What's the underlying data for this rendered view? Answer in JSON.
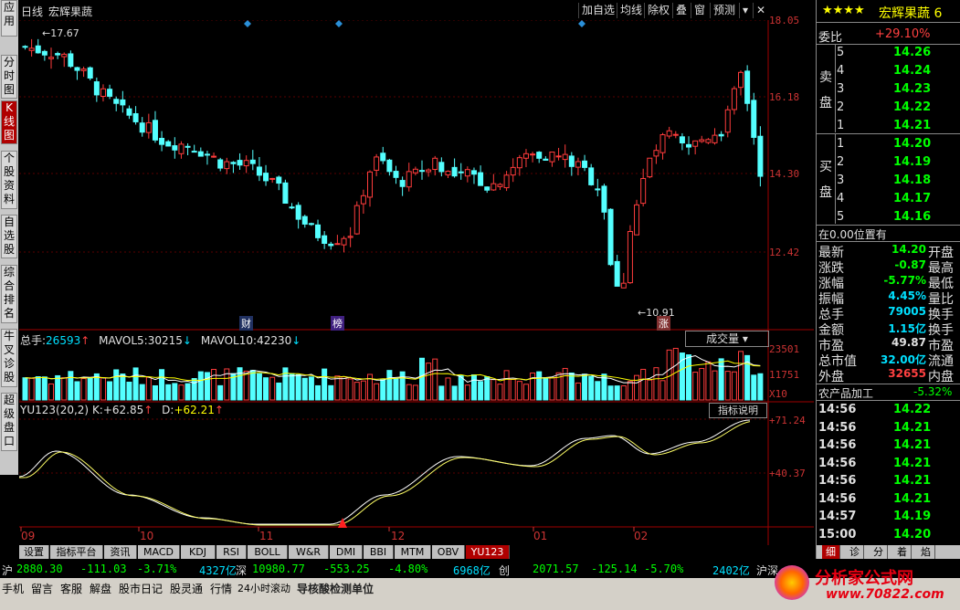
{
  "left_tabs": [
    "应用",
    "分时图",
    "K线图",
    "个股资料",
    "自选股",
    "综合排名",
    "牛叉诊股",
    "超级盘口"
  ],
  "toolbar": {
    "period": "日线",
    "stock_name": "宏辉果蔬",
    "buttons": [
      "加自选",
      "均线",
      "除权",
      "叠",
      "窗",
      "预测"
    ]
  },
  "price_chart": {
    "y_labels": [
      "18.05",
      "16.18",
      "14.30",
      "12.42"
    ],
    "high_marker": "17.67",
    "low_marker": "10.91",
    "events": [
      "财",
      "榜",
      "涨"
    ],
    "x_labels": [
      "09",
      "10",
      "11",
      "12",
      "01",
      "02"
    ]
  },
  "volume": {
    "label": "总手:",
    "value": "26593",
    "ma5_label": "MAVOL5:",
    "ma5": "30215",
    "ma10_label": "MAVOL10:",
    "ma10": "42230",
    "dropdown": "成交量",
    "y_labels": [
      "23501",
      "11751"
    ],
    "unit": "X10"
  },
  "indicator": {
    "name": "YU123(20,2)",
    "k_label": "K:",
    "k": "+62.85",
    "d_label": "D:",
    "d": "+62.21",
    "help_button": "指标说明",
    "y_labels": [
      "+71.24",
      "+40.37"
    ]
  },
  "bottom_tabs": [
    "设置",
    "指标平台",
    "资讯",
    "MACD",
    "KDJ",
    "RSI",
    "BOLL",
    "W&R",
    "DMI",
    "BBI",
    "MTM",
    "OBV",
    "YU123"
  ],
  "status": {
    "sh_label": "沪",
    "sh_index": "2880.30",
    "sh_change": "-111.03",
    "sh_pct": "-3.71%",
    "sh_amount": "4327亿",
    "sz_label": "深",
    "sz_index": "10980.77",
    "sz_change": "-553.25",
    "sz_pct": "-4.80%",
    "sz_amount": "6968亿",
    "cy_label": "创",
    "cy_index": "2071.57",
    "cy_change": "-125.14",
    "cy_pct": "-5.70%",
    "cy_amount": "2402亿",
    "hs_label": "沪深"
  },
  "taskbar": {
    "items": [
      "手机",
      "留言",
      "客服",
      "解盘",
      "股市日记",
      "股灵通",
      "行情",
      "24小时滚动"
    ],
    "ticker": "导核酸检测单位"
  },
  "watermark": {
    "text": "分析家公式网",
    "url": "www.70822.com"
  },
  "right_panel": {
    "stars": "★★★★",
    "name": "宏辉果蔬",
    "name_suffix": "6",
    "weibi_label": "委比",
    "weibi": "+29.10%",
    "sell_label": "卖\n盘",
    "buy_label": "买\n盘",
    "sell": [
      {
        "level": "5",
        "price": "14.26"
      },
      {
        "level": "4",
        "price": "14.24"
      },
      {
        "level": "3",
        "price": "14.23"
      },
      {
        "level": "2",
        "price": "14.22"
      },
      {
        "level": "1",
        "price": "14.21"
      }
    ],
    "buy": [
      {
        "level": "1",
        "price": "14.20"
      },
      {
        "level": "2",
        "price": "14.19"
      },
      {
        "level": "3",
        "price": "14.18"
      },
      {
        "level": "4",
        "price": "14.17"
      },
      {
        "level": "5",
        "price": "14.16"
      }
    ],
    "position_note": "在0.00位置有",
    "stats": [
      {
        "label": "最新",
        "value": "14.20",
        "tail": "开盘"
      },
      {
        "label": "涨跌",
        "value": "-0.87",
        "tail": "最高"
      },
      {
        "label": "涨幅",
        "value": "-5.77%",
        "tail": "最低"
      },
      {
        "label": "振幅",
        "value": "4.45%",
        "tail": "量比"
      },
      {
        "label": "总手",
        "value": "79005",
        "tail": "换手"
      },
      {
        "label": "金额",
        "value": "1.15亿",
        "tail": "换手"
      },
      {
        "label": "市盈",
        "value": "49.87",
        "tail": "市盈"
      },
      {
        "label": "总市值",
        "value": "32.00亿",
        "tail": "流通"
      },
      {
        "label": "外盘",
        "value": "32655",
        "tail": "内盘"
      }
    ],
    "industry": "农产品加工",
    "industry_pct": "-5.32%",
    "ticks": [
      {
        "time": "14:56",
        "price": "14.22"
      },
      {
        "time": "14:56",
        "price": "14.21"
      },
      {
        "time": "14:56",
        "price": "14.21"
      },
      {
        "time": "14:56",
        "price": "14.21"
      },
      {
        "time": "14:56",
        "price": "14.21"
      },
      {
        "time": "14:56",
        "price": "14.21"
      },
      {
        "time": "14:57",
        "price": "14.19"
      },
      {
        "time": "15:00",
        "price": "14.20"
      }
    ],
    "bottom_tabs": [
      "细",
      "诊",
      "分",
      "着",
      "焰"
    ]
  }
}
